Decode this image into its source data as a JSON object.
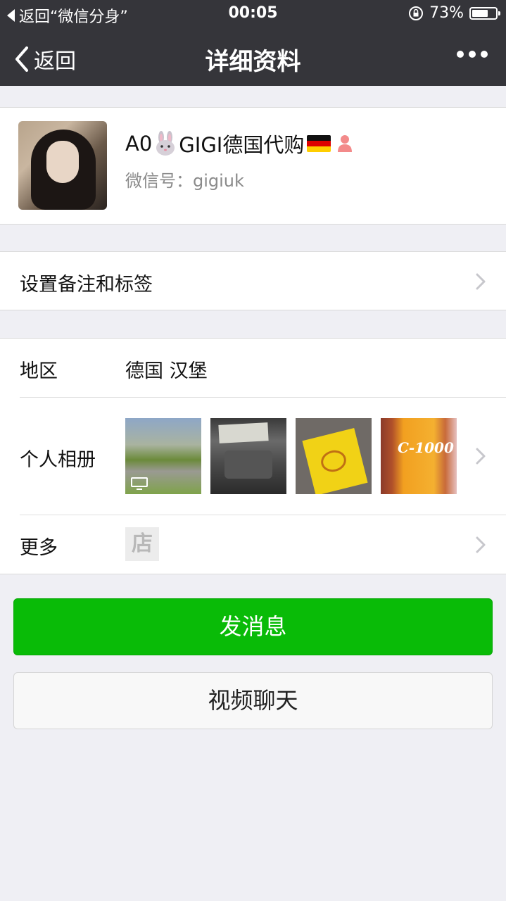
{
  "status_bar": {
    "back_app": "返回“微信分身”",
    "time": "00:05",
    "battery": "73%",
    "battery_level": 0.73
  },
  "nav": {
    "back_label": "返回",
    "title": "详细资料"
  },
  "profile": {
    "name_prefix": "A0",
    "name_main": "GIGI德国代购",
    "wechat_id": "微信号：gigiuk"
  },
  "remark": {
    "label": "设置备注和标签"
  },
  "info": {
    "region_label": "地区",
    "region_value": "德国 汉堡",
    "album_label": "个人相册",
    "album_thumb4_text": "C-1000",
    "more_label": "更多",
    "shop_icon_text": "店"
  },
  "actions": {
    "send_message": "发消息",
    "video_chat": "视频聊天"
  },
  "colors": {
    "nav_bg": "#35353a",
    "primary_green": "#09bb07",
    "page_bg": "#efeff4"
  }
}
